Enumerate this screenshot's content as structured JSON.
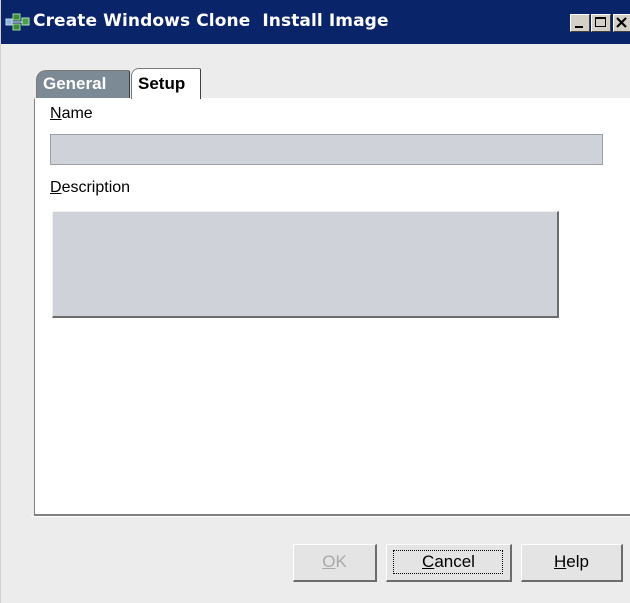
{
  "window": {
    "title": "Create Windows Clone  Install Image"
  },
  "tabs": [
    {
      "label": "General",
      "active": false
    },
    {
      "label": "Setup",
      "active": true
    }
  ],
  "form": {
    "name_label_mnemonic": "N",
    "name_label_rest": "ame",
    "name_value": "",
    "description_label_mnemonic": "D",
    "description_label_rest": "escription",
    "description_value": ""
  },
  "buttons": {
    "ok_mnemonic": "O",
    "ok_rest": "K",
    "ok_enabled": false,
    "cancel_mnemonic": "C",
    "cancel_rest": "ancel",
    "help_mnemonic": "H",
    "help_rest": "elp"
  },
  "colors": {
    "titlebar": "#0a246a",
    "tab_general": "#7c8a96",
    "field_background": "#cfd2d8",
    "dialog_background": "#ececec"
  },
  "icons": {
    "app": "network-computer-icon",
    "minimize": "minimize-icon",
    "maximize": "maximize-icon",
    "close": "close-icon"
  }
}
